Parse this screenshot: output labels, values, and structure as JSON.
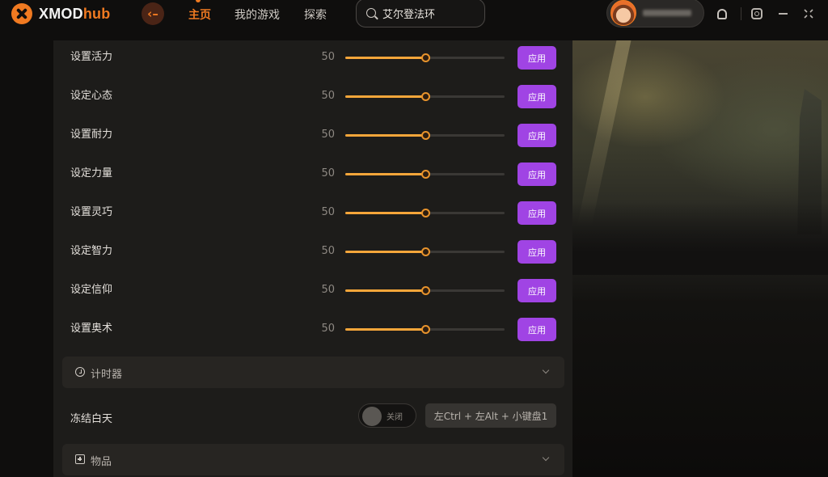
{
  "app": {
    "logo_main": "XMOD",
    "logo_accent": "hub",
    "accent_color": "#f07a21",
    "apply_color": "#a044e4"
  },
  "nav": {
    "back_icon": "arrow-left-icon",
    "items": [
      {
        "label": "主页",
        "active": true
      },
      {
        "label": "我的游戏",
        "active": false
      },
      {
        "label": "探索",
        "active": false
      }
    ]
  },
  "search": {
    "value": "艾尔登法环",
    "icon": "search-icon"
  },
  "toolbar_icons": [
    "bell-icon",
    "settings-hex-icon",
    "minimize-icon",
    "fullscreen-icon"
  ],
  "sliders": [
    {
      "label": "设置活力",
      "value": "50",
      "fraction": 0.5,
      "apply": "应用"
    },
    {
      "label": "设定心态",
      "value": "50",
      "fraction": 0.5,
      "apply": "应用"
    },
    {
      "label": "设置耐力",
      "value": "50",
      "fraction": 0.5,
      "apply": "应用"
    },
    {
      "label": "设定力量",
      "value": "50",
      "fraction": 0.5,
      "apply": "应用"
    },
    {
      "label": "设置灵巧",
      "value": "50",
      "fraction": 0.5,
      "apply": "应用"
    },
    {
      "label": "设定智力",
      "value": "50",
      "fraction": 0.5,
      "apply": "应用"
    },
    {
      "label": "设定信仰",
      "value": "50",
      "fraction": 0.5,
      "apply": "应用"
    },
    {
      "label": "设置奥术",
      "value": "50",
      "fraction": 0.5,
      "apply": "应用"
    }
  ],
  "sections": {
    "timer": {
      "label": "计时器",
      "icon": "clock-icon"
    },
    "items": {
      "label": "物品",
      "icon": "plus-box-icon"
    }
  },
  "freeze": {
    "label": "冻结白天",
    "toggle_state": "关闭",
    "hotkey": "左Ctrl + 左Alt + 小键盘1"
  }
}
